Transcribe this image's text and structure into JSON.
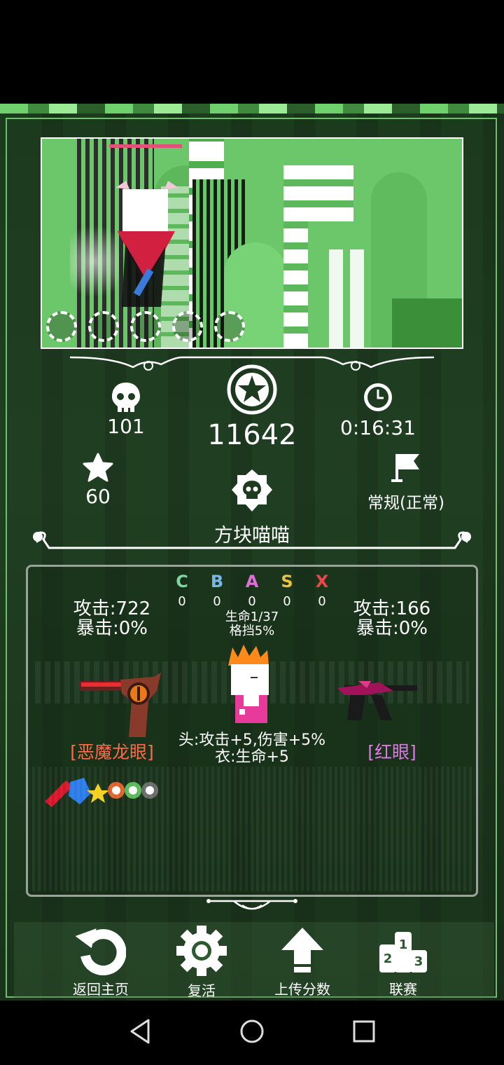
{
  "stats": {
    "kills": "101",
    "score": "11642",
    "time": "0:16:31",
    "stars": "60",
    "mode": "常规(正常)"
  },
  "character": {
    "name": "方块喵喵",
    "life": "生命1/37",
    "block": "格挡5%",
    "bonus_line1": "头:攻击+5,伤害+5%",
    "bonus_line2": "衣:生命+5"
  },
  "ranks": [
    {
      "letter": "C",
      "count": "0",
      "color": "#7fd6a0"
    },
    {
      "letter": "B",
      "count": "0",
      "color": "#7ab6e8"
    },
    {
      "letter": "A",
      "count": "0",
      "color": "#e070d8"
    },
    {
      "letter": "S",
      "count": "0",
      "color": "#e8c24a"
    },
    {
      "letter": "X",
      "count": "0",
      "color": "#e84848"
    }
  ],
  "weapon_left": {
    "attack": "攻击:722",
    "crit": "暴击:0%",
    "name": "[恶魔龙眼]",
    "name_color": "#ff6a4a"
  },
  "weapon_right": {
    "attack": "攻击:166",
    "crit": "暴击:0%",
    "name": "[红眼]",
    "name_color": "#e07ae8"
  },
  "buttons": {
    "home": "返回主页",
    "revive": "复活",
    "upload": "上传分数",
    "league": "联赛"
  },
  "icons": {
    "kills": "skull-icon",
    "score": "star-medal-icon",
    "time": "clock-icon",
    "stars": "star-icon",
    "mode": "flag-icon",
    "character": "skull-badge-icon"
  }
}
